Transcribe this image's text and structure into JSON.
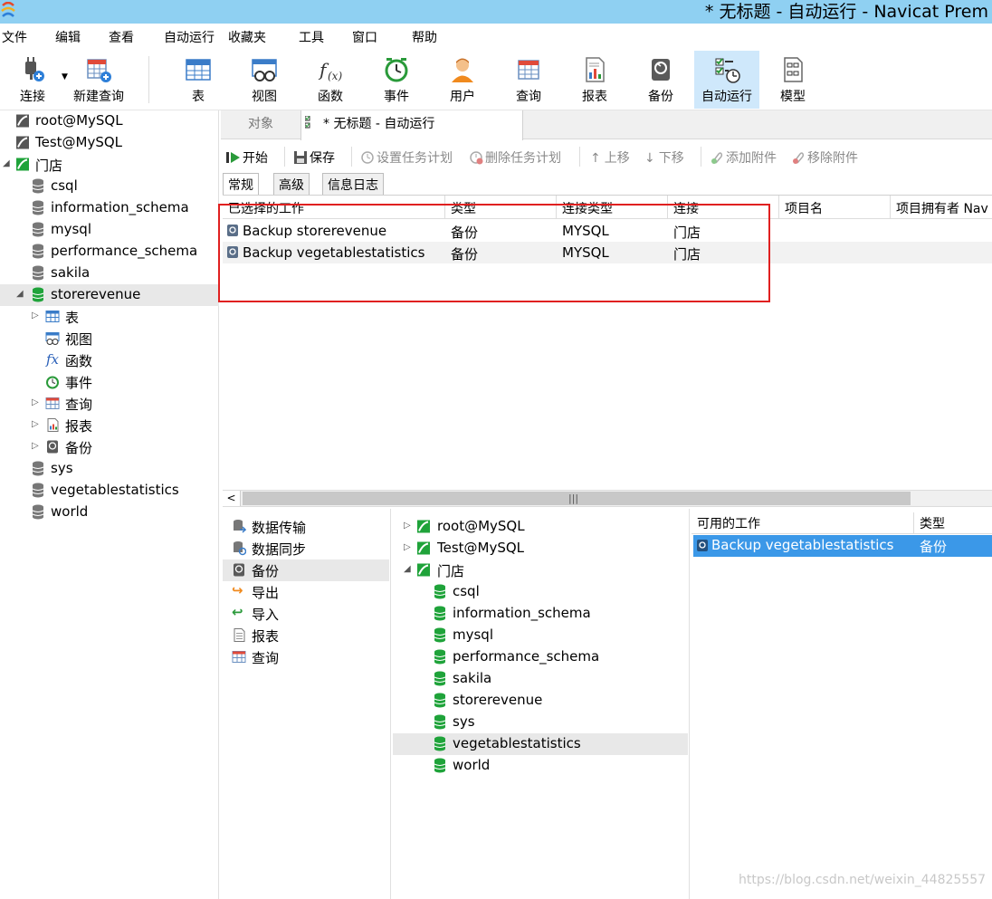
{
  "window": {
    "title": "* 无标题 - 自动运行 - Navicat Prem"
  },
  "menu": [
    "文件",
    "编辑",
    "查看",
    "自动运行",
    "收藏夹",
    "工具",
    "窗口",
    "帮助"
  ],
  "toolbar": {
    "connect": "连接",
    "new_query": "新建查询",
    "table": "表",
    "view": "视图",
    "function": "函数",
    "event": "事件",
    "user": "用户",
    "query": "查询",
    "report": "报表",
    "backup": "备份",
    "automation": "自动运行",
    "model": "模型"
  },
  "tree": {
    "connections": [
      "root@MySQL",
      "Test@MySQL",
      "门店"
    ],
    "databases": [
      "csql",
      "information_schema",
      "mysql",
      "performance_schema",
      "sakila",
      "storerevenue"
    ],
    "children": [
      "表",
      "视图",
      "函数",
      "事件",
      "查询",
      "报表",
      "备份"
    ],
    "databases_after": [
      "sys",
      "vegetablestatistics",
      "world"
    ]
  },
  "tabs": {
    "objects": "对象",
    "active": "* 无标题 - 自动运行"
  },
  "actions": {
    "start": "开始",
    "save": "保存",
    "set_schedule": "设置任务计划",
    "delete_schedule": "删除任务计划",
    "move_up": "上移",
    "move_down": "下移",
    "add_attachment": "添加附件",
    "remove_attachment": "移除附件"
  },
  "subtabs": [
    "常规",
    "高级",
    "信息日志"
  ],
  "grid": {
    "headers": [
      "已选择的工作",
      "类型",
      "连接类型",
      "连接",
      "项目名",
      "项目拥有者 Nav"
    ],
    "rows": [
      [
        "Backup storerevenue",
        "备份",
        "MYSQL",
        "门店"
      ],
      [
        "Backup vegetablestatistics",
        "备份",
        "MYSQL",
        "门店"
      ]
    ]
  },
  "job_types": [
    "数据传输",
    "数据同步",
    "备份",
    "导出",
    "导入",
    "报表",
    "查询"
  ],
  "conn_tree": {
    "connections": [
      "root@MySQL",
      "Test@MySQL",
      "门店"
    ],
    "databases": [
      "csql",
      "information_schema",
      "mysql",
      "performance_schema",
      "sakila",
      "storerevenue",
      "sys",
      "vegetablestatistics",
      "world"
    ]
  },
  "available": {
    "headers": [
      "可用的工作",
      "类型"
    ],
    "rows": [
      [
        "Backup vegetablestatistics",
        "备份"
      ]
    ]
  },
  "watermark": "https://blog.csdn.net/weixin_44825557",
  "colors": {
    "selection": "#3b98e8",
    "titlebar": "#8fd0f2",
    "highlight_box": "#e02020",
    "db_green": "#1fa33a"
  }
}
